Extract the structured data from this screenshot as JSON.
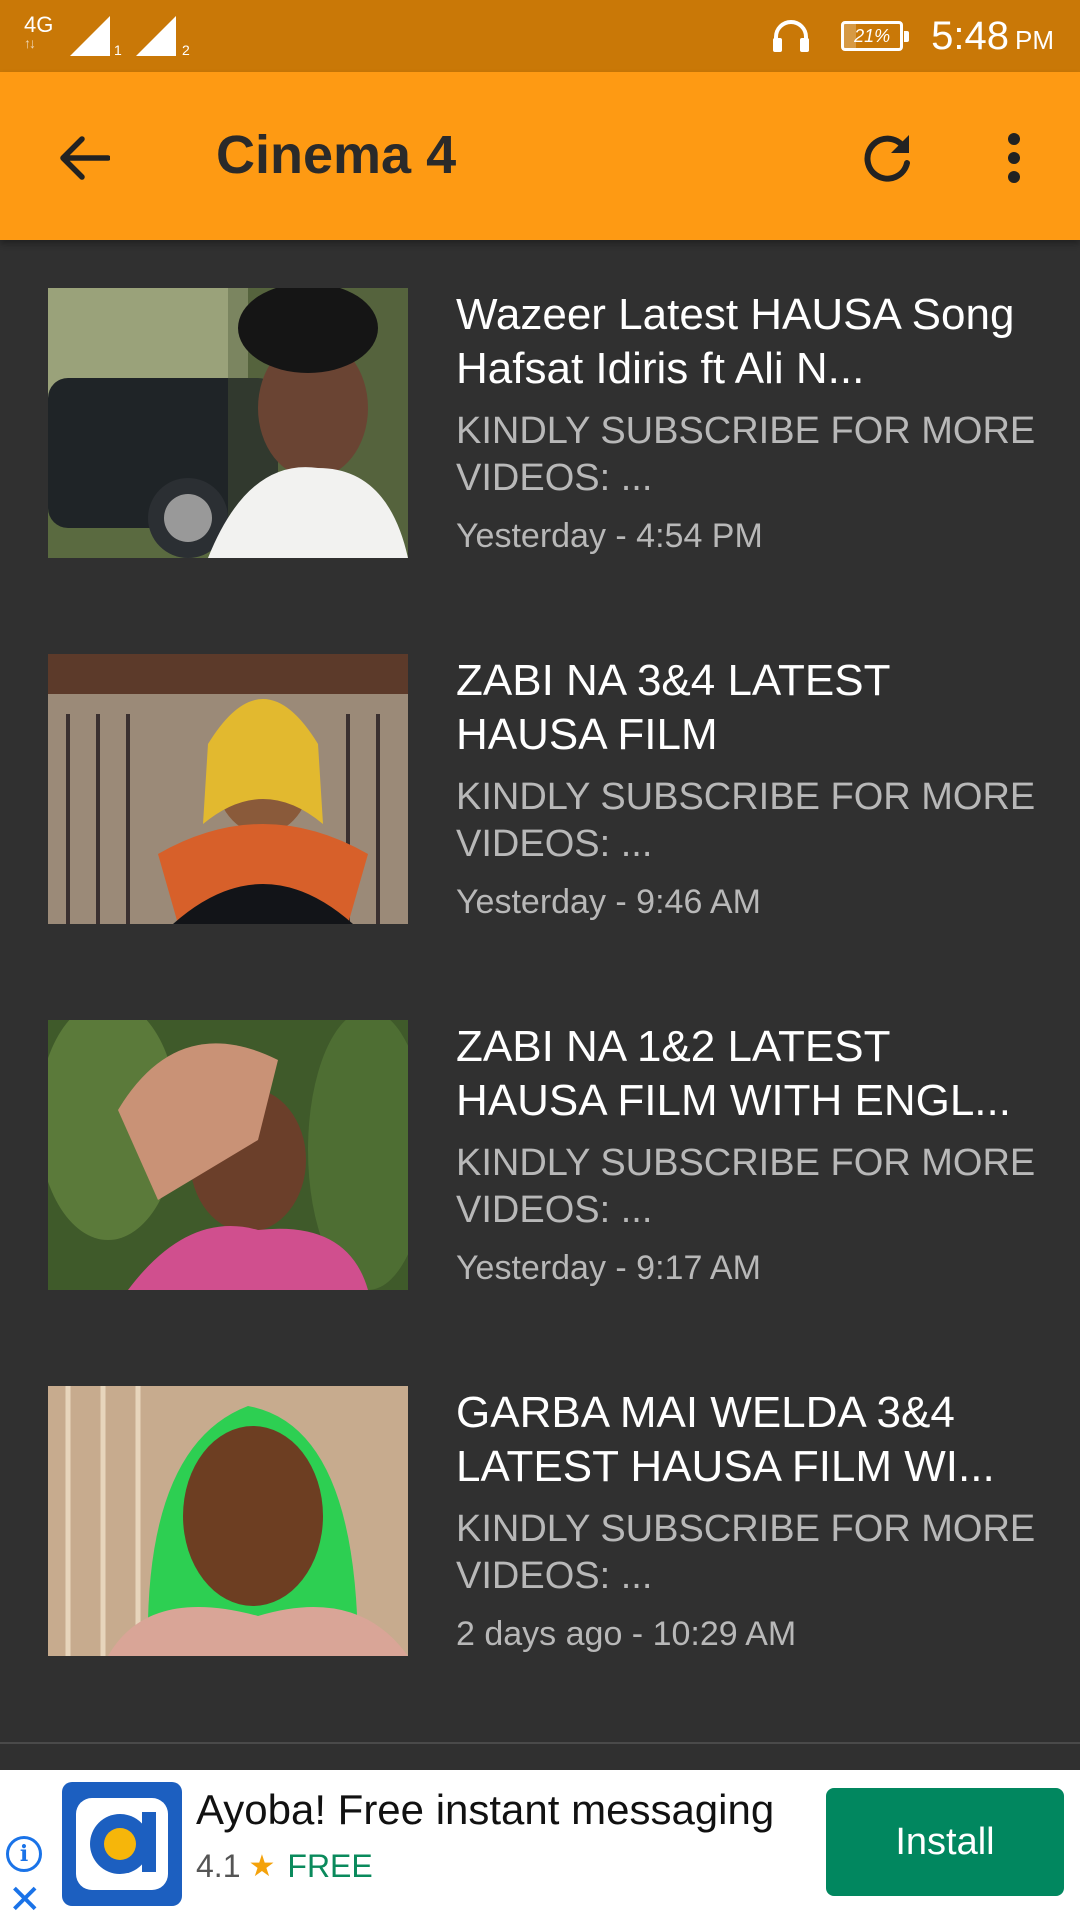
{
  "status_bar": {
    "network": "4G",
    "sim1": "1",
    "sim2": "2",
    "battery": "21%",
    "battery_level": 0.21,
    "time": "5:48",
    "ampm": "PM"
  },
  "app_bar": {
    "title": "Cinema 4",
    "background": "#fe9a13"
  },
  "videos": [
    {
      "title": "Wazeer Latest HAUSA Song Hafsat Idiris ft Ali N...",
      "description": "KINDLY SUBSCRIBE FOR MORE VIDEOS: ...",
      "date": "Yesterday - 4:54 PM"
    },
    {
      "title": "ZABI NA 3&4 LATEST HAUSA FILM",
      "description": "KINDLY SUBSCRIBE FOR MORE VIDEOS: ...",
      "date": "Yesterday - 9:46 AM"
    },
    {
      "title": "ZABI NA 1&2 LATEST HAUSA FILM WITH ENGL...",
      "description": "KINDLY SUBSCRIBE FOR MORE VIDEOS: ...",
      "date": "Yesterday - 9:17 AM"
    },
    {
      "title": "GARBA MAI WELDA 3&4 LATEST HAUSA FILM WI...",
      "description": "KINDLY SUBSCRIBE FOR MORE VIDEOS: ...",
      "date": "2 days ago - 10:29 AM"
    }
  ],
  "ad": {
    "title": "Ayoba! Free instant messaging",
    "rating": "4.1",
    "price": "FREE",
    "install_label": "Install",
    "install_color": "#01875f"
  }
}
